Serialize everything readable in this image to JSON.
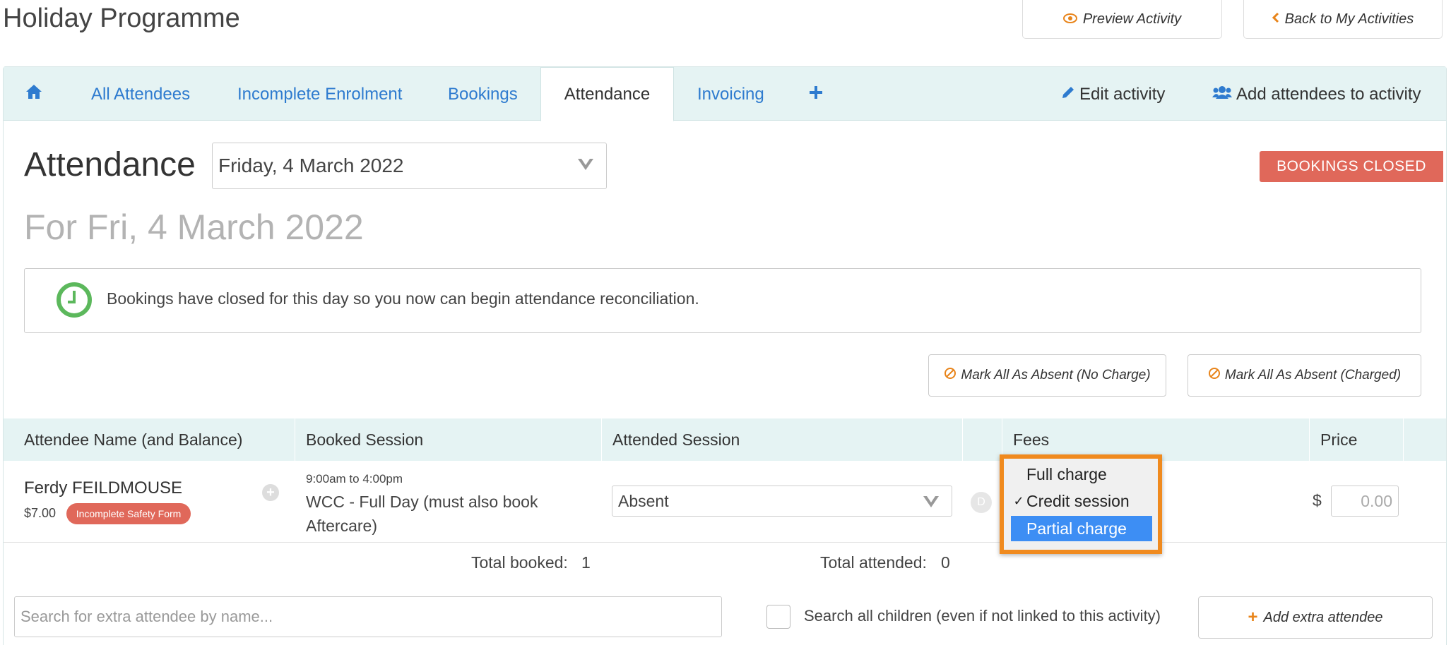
{
  "page": {
    "title": "Holiday Programme"
  },
  "top_buttons": {
    "preview": {
      "label": "Preview Activity",
      "icon": "eye-icon"
    },
    "back": {
      "label": "Back to My Activities",
      "icon": "chevron-left-icon"
    }
  },
  "tabs": [
    {
      "label": "",
      "icon": "home-icon"
    },
    {
      "label": "All Attendees"
    },
    {
      "label": "Incomplete Enrolment"
    },
    {
      "label": "Bookings"
    },
    {
      "label": "Attendance",
      "active": true
    },
    {
      "label": "Invoicing"
    },
    {
      "label": "",
      "icon": "plus-icon"
    }
  ],
  "tab_actions": {
    "edit": {
      "label": "Edit activity",
      "icon": "pencil-icon"
    },
    "add": {
      "label": "Add attendees to activity",
      "icon": "users-icon"
    }
  },
  "attendance": {
    "title": "Attendance",
    "date_selected": "Friday, 4 March 2022",
    "status_badge": "BOOKINGS  CLOSED",
    "for_date": "For Fri, 4 March 2022",
    "info_message": "Bookings have closed for this day so you now can begin attendance reconciliation."
  },
  "bulk_actions": {
    "no_charge": "Mark All As Absent (No Charge)",
    "charged": "Mark All As Absent (Charged)"
  },
  "table": {
    "headers": {
      "name": "Attendee Name (and Balance)",
      "booked": "Booked Session",
      "attended": "Attended Session",
      "fees": "Fees",
      "price": "Price"
    },
    "rows": [
      {
        "name": "Ferdy FEILDMOUSE",
        "balance": "$7.00",
        "badge": "Incomplete Safety Form",
        "session_time": "9:00am to 4:00pm",
        "session_name": "WCC - Full Day (must also book Aftercare)",
        "attended_value": "Absent",
        "d_label": "D",
        "currency": "$",
        "price": "0.00"
      }
    ]
  },
  "fees_dropdown": {
    "options": [
      {
        "label": "Full charge",
        "checked": false,
        "highlighted": false
      },
      {
        "label": "Credit session",
        "checked": true,
        "highlighted": false
      },
      {
        "label": "Partial charge",
        "checked": false,
        "highlighted": true
      }
    ],
    "highlight_color": "#3d8ef4",
    "border_color": "#f08a1e"
  },
  "totals": {
    "booked_label": "Total booked:",
    "booked_value": "1",
    "attended_label": "Total attended:",
    "attended_value": "0"
  },
  "footer": {
    "search_placeholder": "Search for extra attendee by name...",
    "checkbox_label": "Search all children (even if not linked to this activity)",
    "add_button": "Add extra attendee"
  },
  "colors": {
    "accent_blue": "#2e7bcf",
    "tab_bg": "#e5f3f3",
    "badge_red": "#e0685a",
    "icon_orange": "#e8841a",
    "success_green": "#5cb85c"
  }
}
